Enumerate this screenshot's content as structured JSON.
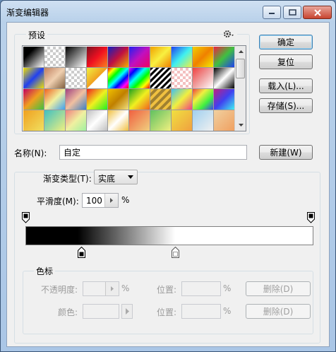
{
  "window": {
    "title": "渐变编辑器"
  },
  "presets": {
    "legend": "预设",
    "menu_icon": "gear-icon",
    "swatches": [
      "linear-gradient(135deg,#000,#000 30%,#fff)",
      "repeating-conic-gradient(#ccc 0 25%,#fff 0 50%) 0 0/8px 8px",
      "linear-gradient(135deg,#000,#fff)",
      "linear-gradient(135deg,#7a1020,#f01020,#f88020)",
      "linear-gradient(135deg,#1020c0,#c01040,#f0b000)",
      "linear-gradient(135deg,#2020f0,#c010c0,#f00060)",
      "linear-gradient(135deg,#f0a000,#f8f040,#f08000)",
      "linear-gradient(135deg,#2040f0,#40f0f0,#f0f040)",
      "linear-gradient(135deg,#f0d000,#f08000,#f0f000)",
      "linear-gradient(135deg,#f02040,#40c040,#2040f0)",
      "linear-gradient(135deg,#f0e000,#2040f0,#f0e000)",
      "linear-gradient(135deg,#c08060,#f0d0b0,#806040)",
      "repeating-conic-gradient(#ccc 0 25%,#fff 0 50%) 0 0/8px 8px",
      "linear-gradient(135deg,#f0f040,#f0a020 50%,#fff 52%,#fff)",
      "linear-gradient(135deg,#f00,#ff0,#0f0,#0ff,#00f,#f0f,#f00)",
      "linear-gradient(135deg,#f0f,#00f,#0ff,#0f0,#ff0,#f00)",
      "repeating-linear-gradient(135deg,#000 0 3px,#fff 3px 6px)",
      "repeating-conic-gradient(#f4c0c0 0 25%,#fff 0 50%) 0 0/8px 8px",
      "linear-gradient(135deg,#f04040,#f0a0a0,#fff)",
      "linear-gradient(135deg,#000,#fff 50%,#000)",
      "linear-gradient(135deg,#c00060,#f0a020,#40c040)",
      "linear-gradient(135deg,#f06020,#f0f0a0,#40a0f0)",
      "linear-gradient(135deg,#a04080,#f0c0a0,#4080c0)",
      "linear-gradient(135deg,#f02020,#f0f020,#20f020)",
      "linear-gradient(135deg,#f0c000,#c08000,#f0e080)",
      "linear-gradient(135deg,#20a020,#f0f020,#f06020)",
      "repeating-linear-gradient(135deg,#f0c040 0 4px,#a08030 4px 8px)",
      "linear-gradient(135deg,#40c0f0,#f0f040,#f04080)",
      "linear-gradient(135deg,#f04040,#f0f040,#40f040,#4040f0)",
      "linear-gradient(135deg,#c02080,#4040f0,#40f0f0)",
      "linear-gradient(135deg,#f0a020,#f0e060)",
      "linear-gradient(135deg,#40c0c0,#f0f080)",
      "linear-gradient(135deg,#f08080,#f0f0a0,#a0f0a0)",
      "linear-gradient(135deg,#c0c0c0,#fff,#c0c0c0)",
      "linear-gradient(135deg,#f0c040,#fff,#f0c040)",
      "linear-gradient(135deg,#f06040,#f0d080)",
      "linear-gradient(135deg,#60c060,#f0f080)",
      "linear-gradient(135deg,#f0e040,#f0a040)",
      "linear-gradient(135deg,#a0d0f0,#f0f0f0)",
      "linear-gradient(135deg,#f0d0a0,#f0a060)"
    ]
  },
  "buttons": {
    "ok": "确定",
    "reset": "复位",
    "load": "载入(L)...",
    "save": "存储(S)...",
    "new": "新建(W)"
  },
  "name": {
    "label": "名称(N):",
    "value": "自定"
  },
  "gradient": {
    "type_label": "渐变类型(T):",
    "type_value": "实底",
    "smoothness_label": "平滑度(M):",
    "smoothness_value": "100",
    "smoothness_unit": "%"
  },
  "color_stops": {
    "legend": "色标",
    "opacity_label": "不透明度:",
    "opacity_unit": "%",
    "opacity_location_label": "位置:",
    "opacity_location_unit": "%",
    "opacity_delete": "删除(D)",
    "color_label": "颜色:",
    "color_location_label": "位置:",
    "color_location_unit": "%",
    "color_delete": "删除(D)"
  }
}
